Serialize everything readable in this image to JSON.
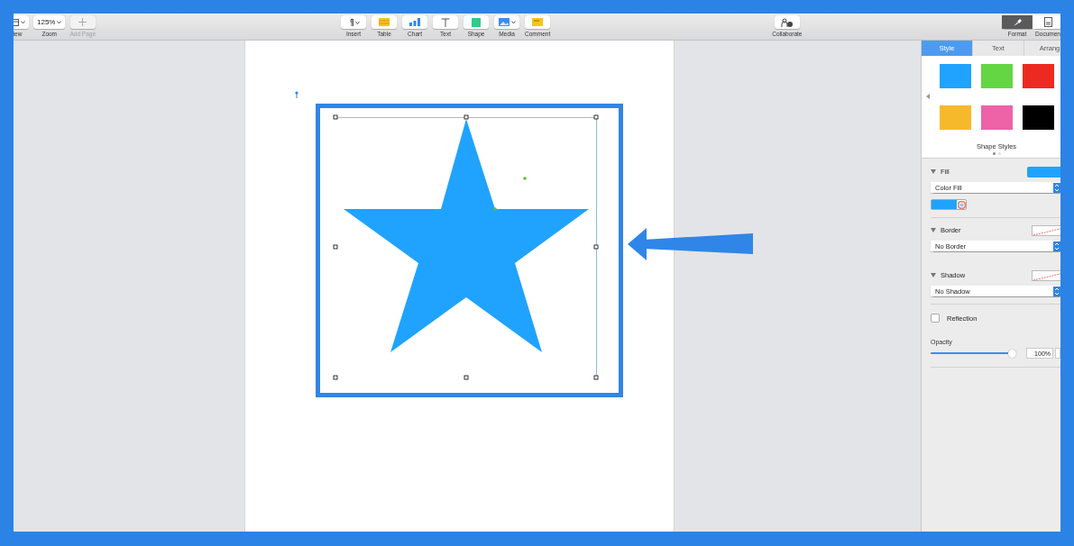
{
  "toolbar": {
    "left": [
      {
        "kind": "view",
        "label": "iew",
        "disabled": false
      },
      {
        "kind": "zoom",
        "label": "Zoom",
        "value": "125%",
        "disabled": false
      },
      {
        "kind": "add",
        "label": "Add Page",
        "disabled": true
      }
    ],
    "center": [
      {
        "kind": "insert",
        "label": "Insert"
      },
      {
        "kind": "table",
        "label": "Table"
      },
      {
        "kind": "chart",
        "label": "Chart"
      },
      {
        "kind": "text",
        "label": "Text"
      },
      {
        "kind": "shape",
        "label": "Shape"
      },
      {
        "kind": "media",
        "label": "Media"
      },
      {
        "kind": "comment",
        "label": "Comment"
      }
    ],
    "collaborate": {
      "label": "Collaborate"
    },
    "right": [
      {
        "kind": "format",
        "label": "Format",
        "selected": true
      },
      {
        "kind": "document",
        "label": "Documen",
        "selected": false
      }
    ]
  },
  "inspector": {
    "tabs": [
      {
        "label": "Style",
        "selected": true
      },
      {
        "label": "Text",
        "selected": false
      },
      {
        "label": "Arrang",
        "selected": false
      }
    ],
    "shape_styles": {
      "label": "Shape Styles",
      "swatches": [
        {
          "color": "#1fa3fe"
        },
        {
          "color": "#64d643"
        },
        {
          "color": "#ec2a22"
        },
        {
          "color": "#f7b92c"
        },
        {
          "color": "#ee62a8"
        },
        {
          "color": "#000000"
        }
      ]
    },
    "sections": [
      {
        "kind": "fill",
        "title": "Fill",
        "value": "Color Fill",
        "expanded": true
      },
      {
        "kind": "border",
        "title": "Border",
        "value": "No Border",
        "expanded": true
      },
      {
        "kind": "shadow",
        "title": "Shadow",
        "value": "No Shadow",
        "expanded": true
      }
    ],
    "reflection": {
      "label": "Reflection",
      "checked": false
    },
    "opacity": {
      "label": "Opacity",
      "level": 0.97,
      "reading": "100%"
    }
  }
}
